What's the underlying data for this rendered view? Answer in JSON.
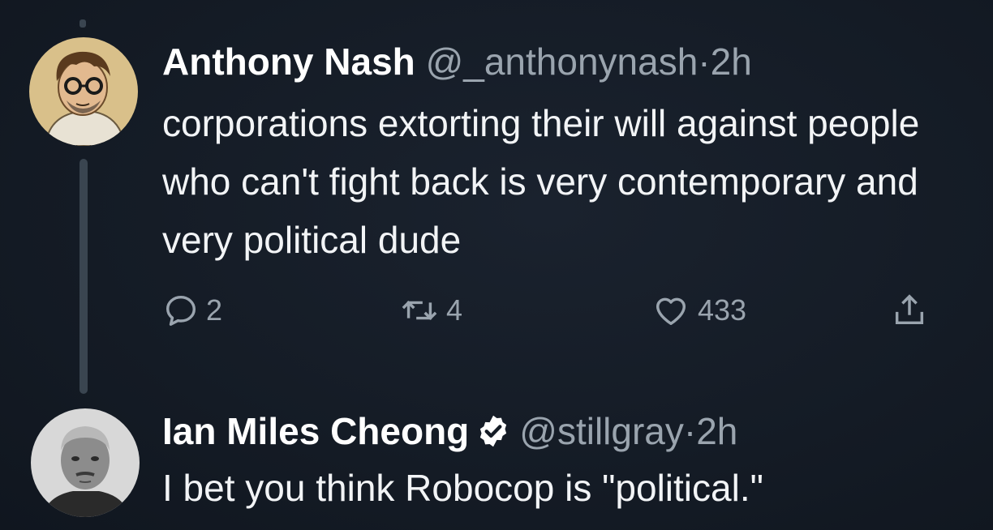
{
  "colors": {
    "background": "#151c26",
    "secondary_text": "#9aa4ae",
    "thread_line": "#3a4550"
  },
  "tweets": [
    {
      "name": "Anthony Nash",
      "handle": "@_anthonynash",
      "separator": "·",
      "time": "2h",
      "text": "corporations extorting their will against people who can't fight back is very contemporary and very political dude",
      "avatar_icon": "cartoon-avatar",
      "actions": {
        "reply_icon": "reply-icon",
        "reply_count": "2",
        "retweet_icon": "retweet-icon",
        "retweet_count": "4",
        "like_icon": "heart-icon",
        "like_count": "433",
        "share_icon": "share-icon"
      }
    },
    {
      "name": "Ian Miles Cheong",
      "verified_icon": "verified-badge-icon",
      "handle": "@stillgray",
      "separator": "·",
      "time": "2h",
      "text": "I bet you think Robocop is \"political.\"",
      "avatar_icon": "photo-avatar"
    }
  ]
}
